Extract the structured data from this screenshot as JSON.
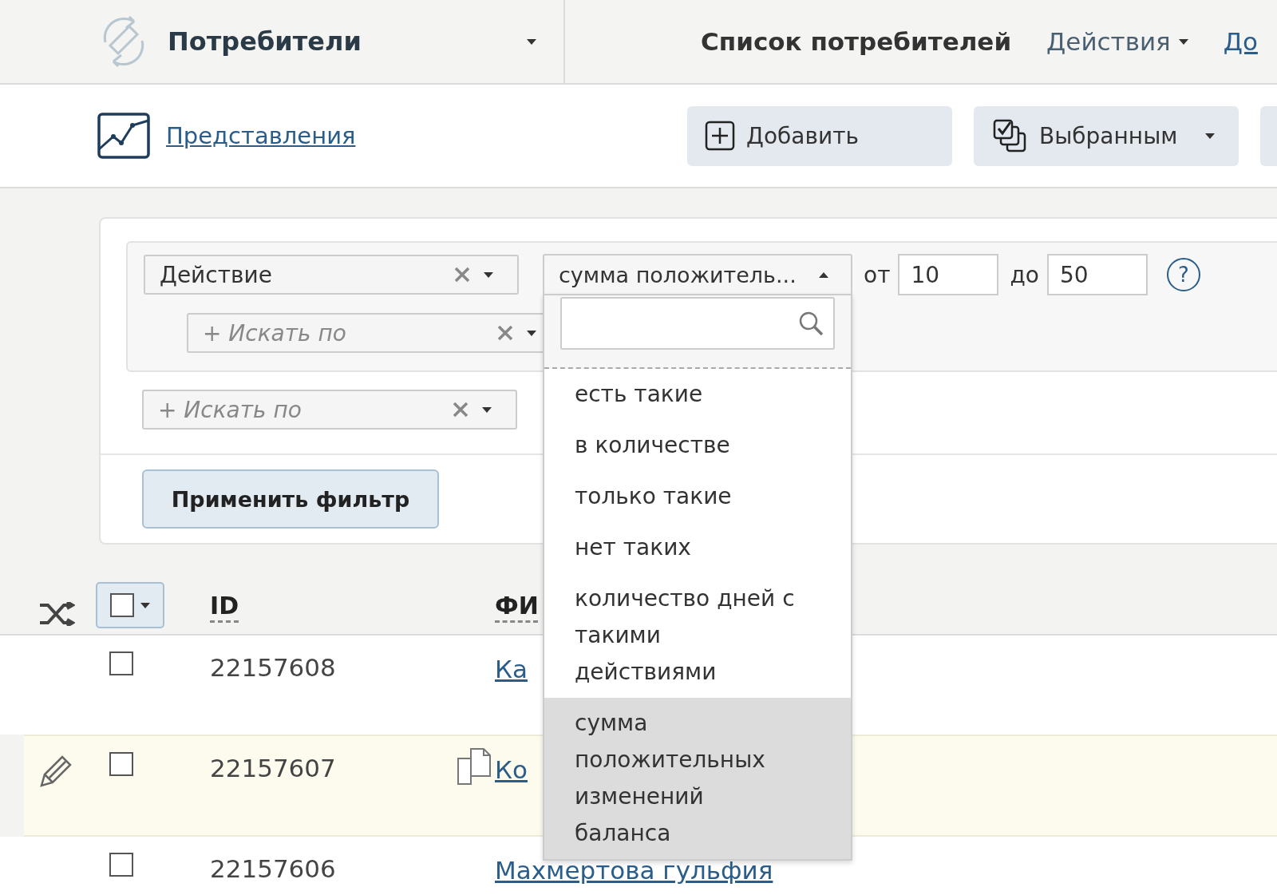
{
  "header": {
    "section_title": "Потребители",
    "page_title": "Список потребителей",
    "menu": [
      {
        "label": "Действия",
        "kind": "dropdown"
      },
      {
        "label": "До",
        "kind": "link"
      }
    ]
  },
  "toolbar": {
    "views_link": "Представления",
    "buttons": [
      {
        "label": "Добавить",
        "kind": "add"
      },
      {
        "label": "Выбранным",
        "kind": "selected"
      },
      {
        "kind": "more"
      }
    ]
  },
  "filter": {
    "condition": {
      "field": "Действие",
      "mode": {
        "value": "сумма положитель...",
        "expanded": true
      },
      "from_label": "от",
      "from": "10",
      "to_label": "до",
      "to": "50",
      "help": "?"
    },
    "nested_search": {
      "placeholder": "+ Искать по"
    },
    "search": {
      "placeholder": "+ Искать по"
    },
    "apply_button": "Применить фильтр"
  },
  "mode_options": [
    {
      "label": "есть такие",
      "selected": false
    },
    {
      "label": "в количестве",
      "selected": false
    },
    {
      "label": "только такие",
      "selected": false
    },
    {
      "label": "нет таких",
      "selected": false
    },
    {
      "label": "количество дней с такими действиями",
      "selected": false
    },
    {
      "label": "сумма положительных изменений баланса",
      "selected": true
    }
  ],
  "table": {
    "select_all": {
      "checked": false
    },
    "columns": [
      "ID",
      "ФИ"
    ],
    "rows": [
      {
        "id": "22157608",
        "name": "Ка",
        "checked": false,
        "highlighted": false,
        "copy_icon": false
      },
      {
        "id": "22157607",
        "name": "Ко",
        "checked": false,
        "highlighted": true,
        "copy_icon": true
      },
      {
        "id": "22157606",
        "name": "Махмертова гульфия",
        "checked": false,
        "highlighted": false,
        "copy_icon": false
      }
    ]
  }
}
